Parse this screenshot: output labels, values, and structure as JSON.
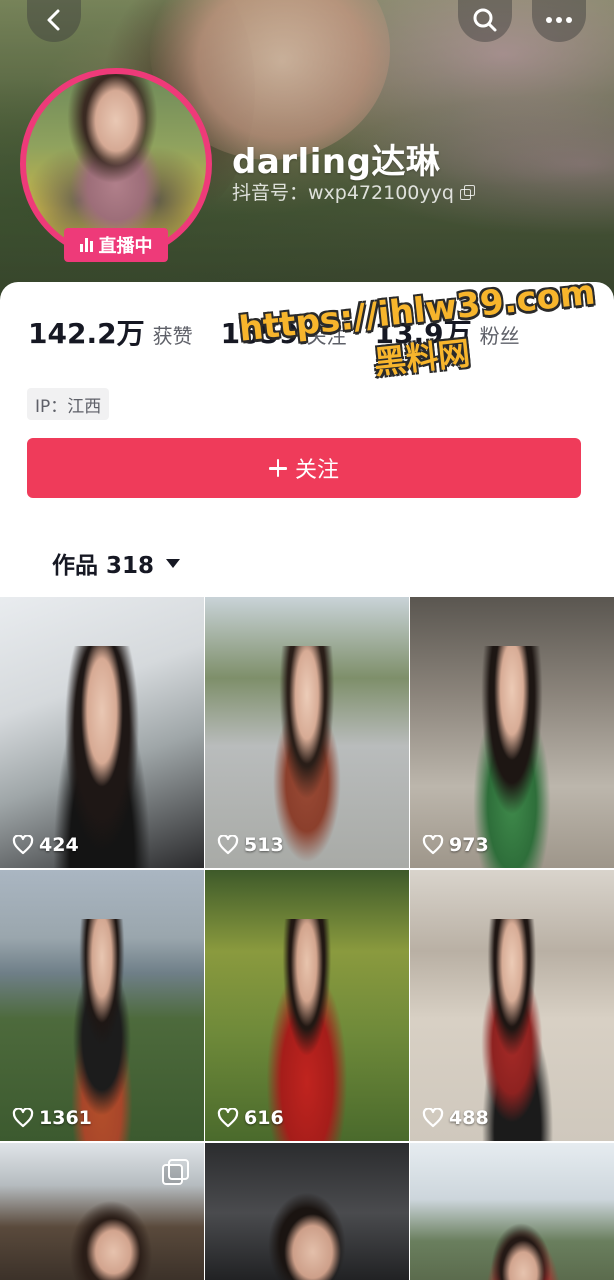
{
  "profile": {
    "username": "darling达琳",
    "douyin_id": "抖音号：wxp472100yyq",
    "live_badge": "直播中",
    "ip": "IP：江西"
  },
  "stats": [
    {
      "num": "142.2万",
      "label": "获赞"
    },
    {
      "num": "1659",
      "label": "关注"
    },
    {
      "num": "13.9万",
      "label": "粉丝"
    }
  ],
  "follow_button": {
    "label": "关注"
  },
  "works_tab": {
    "label": "作品 318"
  },
  "watermark": {
    "url": "https://ihlw39.com",
    "text": "黑料网"
  },
  "posts": [
    {
      "likes": "424"
    },
    {
      "likes": "513"
    },
    {
      "likes": "973"
    },
    {
      "likes": "1361"
    },
    {
      "likes": "616"
    },
    {
      "likes": "488"
    },
    {
      "likes": ""
    },
    {
      "likes": ""
    },
    {
      "likes": ""
    }
  ],
  "icons": {
    "back": "chevron-left-icon",
    "search": "search-icon",
    "more": "more-icon",
    "heart": "heart-outline-icon",
    "multi": "multi-image-icon"
  },
  "colors": {
    "accent_red": "#ef3b5a",
    "live_pink": "#ee3a79"
  }
}
